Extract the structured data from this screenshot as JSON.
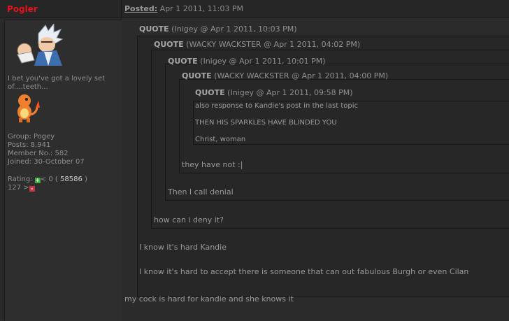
{
  "user": {
    "name": "Pogler",
    "title": "I bet you've got a lovely set of....teeth...",
    "group": "Group: Pogey",
    "posts": "Posts: 8,941",
    "member_no": "Member No.: 582",
    "joined": "Joined: 30-October 07",
    "rating_label": "Rating:",
    "rating_mid": "< 0 (",
    "rating_value": "58586",
    "rating_close": ")",
    "rating_line2": "127 >"
  },
  "post": {
    "posted_label": "Posted:",
    "posted_date": "Apr 1 2011, 11:03 PM",
    "quotes": [
      {
        "label": "QUOTE",
        "meta": "(Inigey @ Apr 1 2011, 10:03 PM)"
      },
      {
        "label": "QUOTE",
        "meta": "(WACKY WACKSTER @ Apr 1 2011, 04:02 PM)"
      },
      {
        "label": "QUOTE",
        "meta": "(Inigey @ Apr 1 2011, 10:01 PM)"
      },
      {
        "label": "QUOTE",
        "meta": "(WACKY WACKSTER @ Apr 1 2011, 04:00 PM)"
      },
      {
        "label": "QUOTE",
        "meta": "(Inigey @ Apr 1 2011, 09:58 PM)"
      }
    ],
    "innermost_lines": [
      "also response to Kandie's post in the last topic",
      "THEN HIS SPARKLES HAVE BLINDED YOU",
      "Christ, woman"
    ],
    "reply_q4": "they have not :|",
    "reply_q3": "Then I call denial",
    "reply_q2": "how can i deny it?",
    "reply_q1_a": "I know it's hard Kandie",
    "reply_q1_b": "I know it's hard to accept there is someone that can out fabulous Burgh or even Cilan",
    "main_text": "my cock is hard for kandie and she knows it"
  },
  "icons": {
    "rating_up": "plus-icon",
    "rating_down": "minus-icon"
  }
}
